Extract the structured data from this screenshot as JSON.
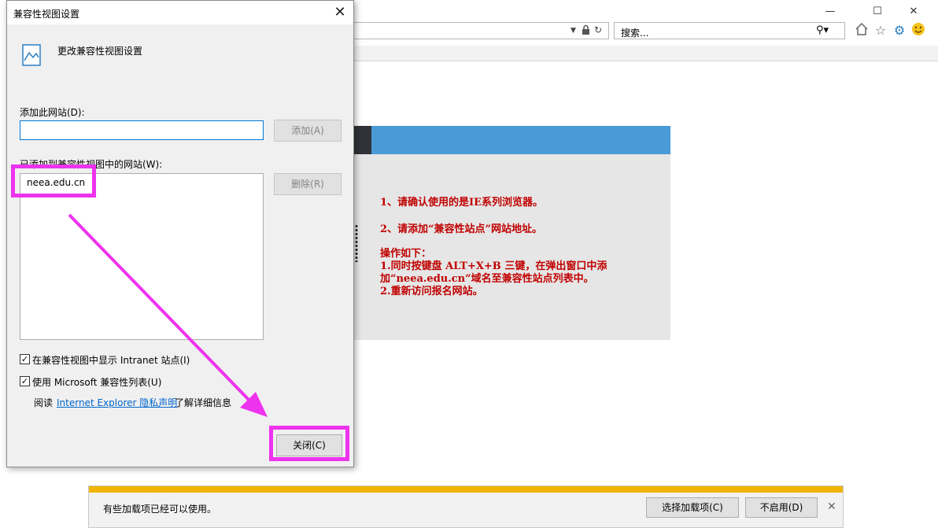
{
  "browser": {
    "search_placeholder": "搜索...",
    "window_controls": [
      "—",
      "☐",
      "✕"
    ],
    "toolbar_icons": [
      "home-icon",
      "favorites-star-icon",
      "settings-gear-icon",
      "smiley-icon"
    ],
    "address_icons": [
      "dropdown-arrow-icon",
      "lock-icon",
      "refresh-icon"
    ]
  },
  "page": {
    "notice_line1": "1、请确认使用的是IE系列浏览器。",
    "notice_line2": "2、请添加“兼容性站点”网站地址。",
    "steps_title": "操作如下：",
    "step1_a": "1.同时按键盘 ALT+X+B 三键，在弹出窗口中添",
    "step1_b": "加“neea.edu.cn”域名至兼容性站点列表中。",
    "step2": "2.重新访问报名网站。",
    "colors": {
      "accent_blue": "#4a9ad8",
      "notice_red": "#c00000",
      "panel_gray": "#e6e6e6"
    }
  },
  "dialog": {
    "title": "兼容性视图设置",
    "header_text": "更改兼容性视图设置",
    "add_site_label": "添加此网站(D):",
    "add_site_value": "",
    "add_button": "添加(A)",
    "added_sites_label": "已添加到兼容性视图中的网站(W):",
    "sites": [
      "neea.edu.cn"
    ],
    "remove_button": "删除(R)",
    "checkbox_intranet_label": "在兼容性视图中显示 Intranet 站点(I)",
    "checkbox_intranet_checked": true,
    "checkbox_mslist_label": "使用 Microsoft 兼容性列表(U)",
    "checkbox_mslist_checked": true,
    "privacy_prefix": "阅读",
    "privacy_link": "Internet Explorer 隐私声明",
    "privacy_suffix": "了解详细信息",
    "close_button": "关闭(C)"
  },
  "annotation": {
    "highlight_color": "#ee33ee"
  },
  "notification": {
    "message": "有些加载项已经可以使用。",
    "choose_button": "选择加载项(C)",
    "disable_button": "不启用(D)",
    "dismiss": "✕"
  }
}
